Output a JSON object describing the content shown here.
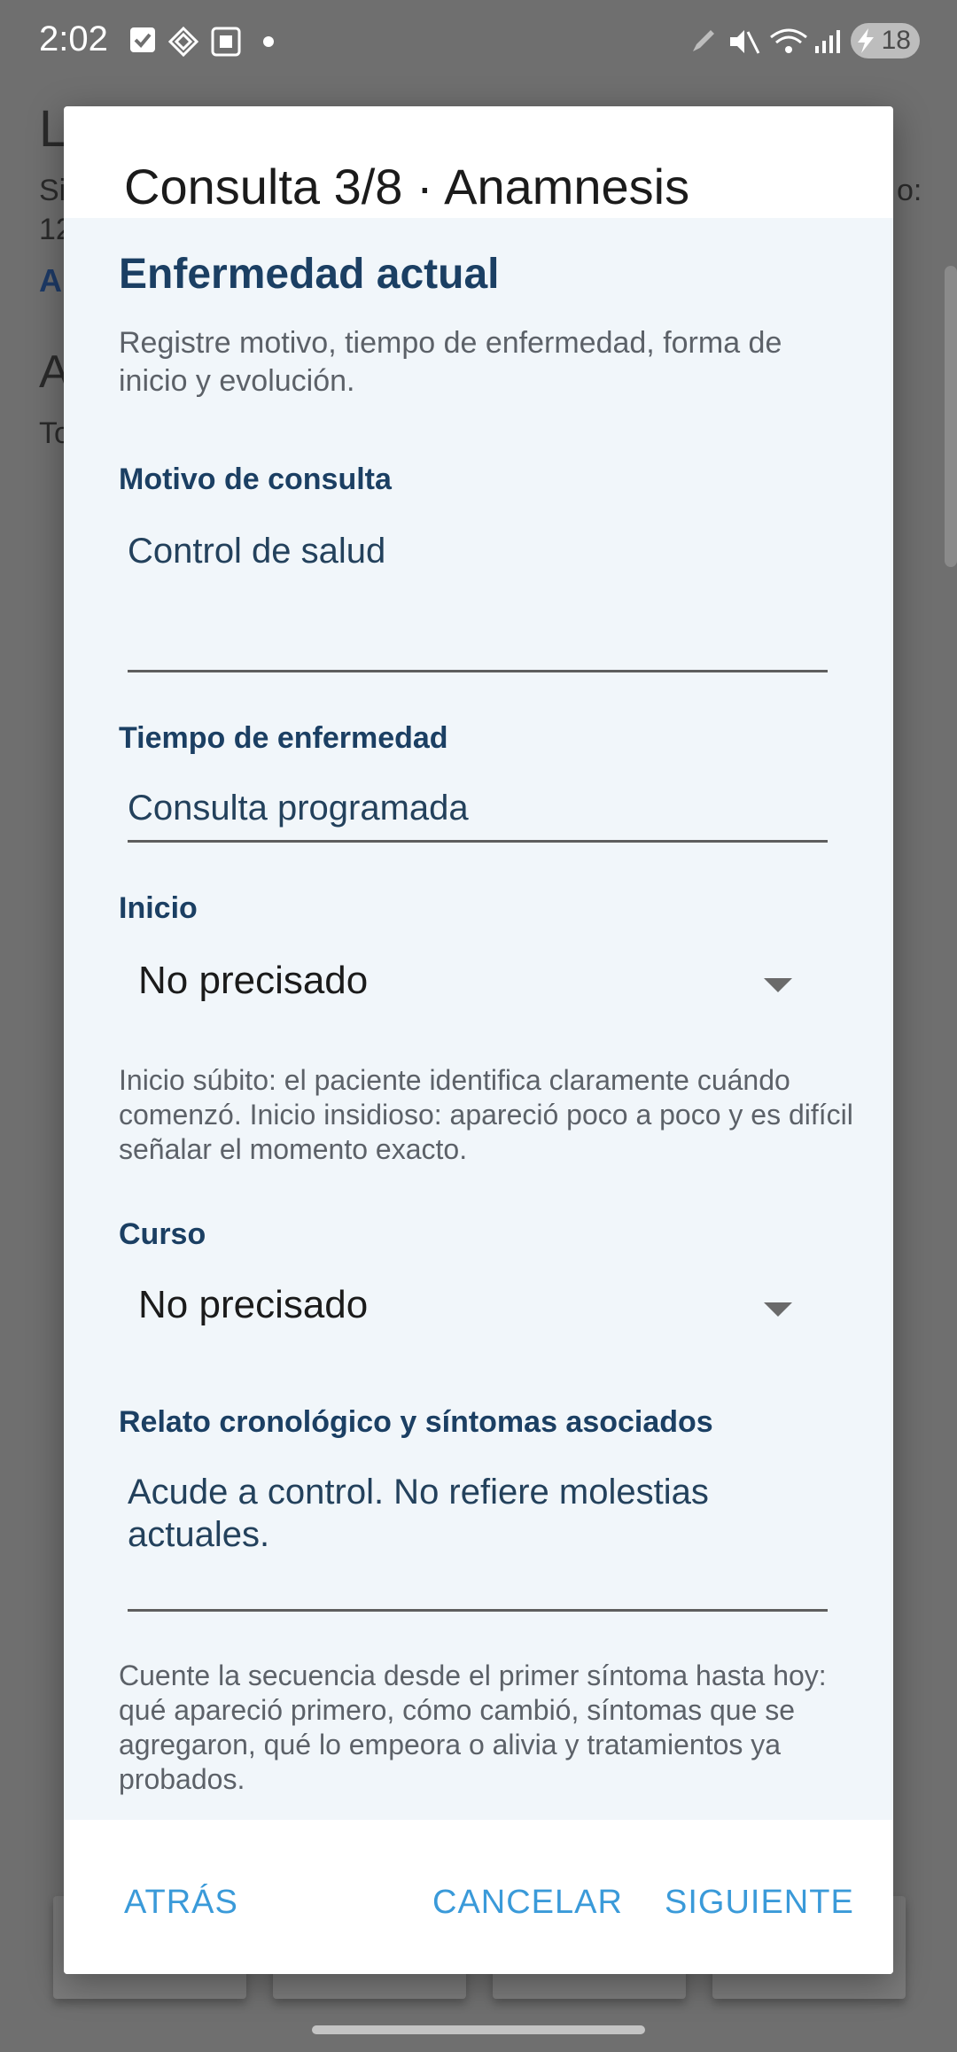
{
  "status_bar": {
    "time": "2:02",
    "battery": "18",
    "icons": [
      "checkbox-icon",
      "diamond-app-icon",
      "square-app-icon",
      "dot-icon",
      "pen-icon",
      "mute-icon",
      "wifi-icon",
      "signal-icon",
      "charging-icon"
    ]
  },
  "background_page": {
    "title_fragment": "L",
    "line1_fragment": "Si",
    "line1_end_fragment": "o:",
    "line2_fragment": "12",
    "link_fragment": "A",
    "heading2_fragment": "A",
    "line3_fragment": "To"
  },
  "dialog": {
    "title": "Consulta 3/8 · Anamnesis",
    "section_title": "Enfermedad actual",
    "section_description": "Registre motivo, tiempo de enfermedad, forma de inicio y evolución.",
    "fields": {
      "motivo": {
        "label": "Motivo de consulta",
        "value": "Control de salud"
      },
      "tiempo": {
        "label": "Tiempo de enfermedad",
        "value": "Consulta programada"
      },
      "inicio": {
        "label": "Inicio",
        "selected": "No precisado",
        "helper": "Inicio súbito: el paciente identifica claramente cuándo comenzó. Inicio insidioso: apareció poco a poco y es difícil señalar el momento exacto."
      },
      "curso": {
        "label": "Curso",
        "selected": "No precisado"
      },
      "relato": {
        "label": "Relato cronológico y síntomas asociados",
        "value": "Acude a control. No refiere molestias actuales.",
        "helper": "Cuente la secuencia desde el primer síntoma hasta hoy: qué apareció primero, cómo cambió, síntomas que se agregaron, qué lo empeora o alivia y tratamientos ya probados."
      }
    },
    "actions": {
      "back": "ATRÁS",
      "cancel": "CANCELAR",
      "next": "SIGUIENTE"
    }
  },
  "colors": {
    "accent": "#3a9ad9",
    "label": "#1b3f63",
    "body_bg": "#f1f6fa",
    "scrim": "#6f6f6f"
  }
}
